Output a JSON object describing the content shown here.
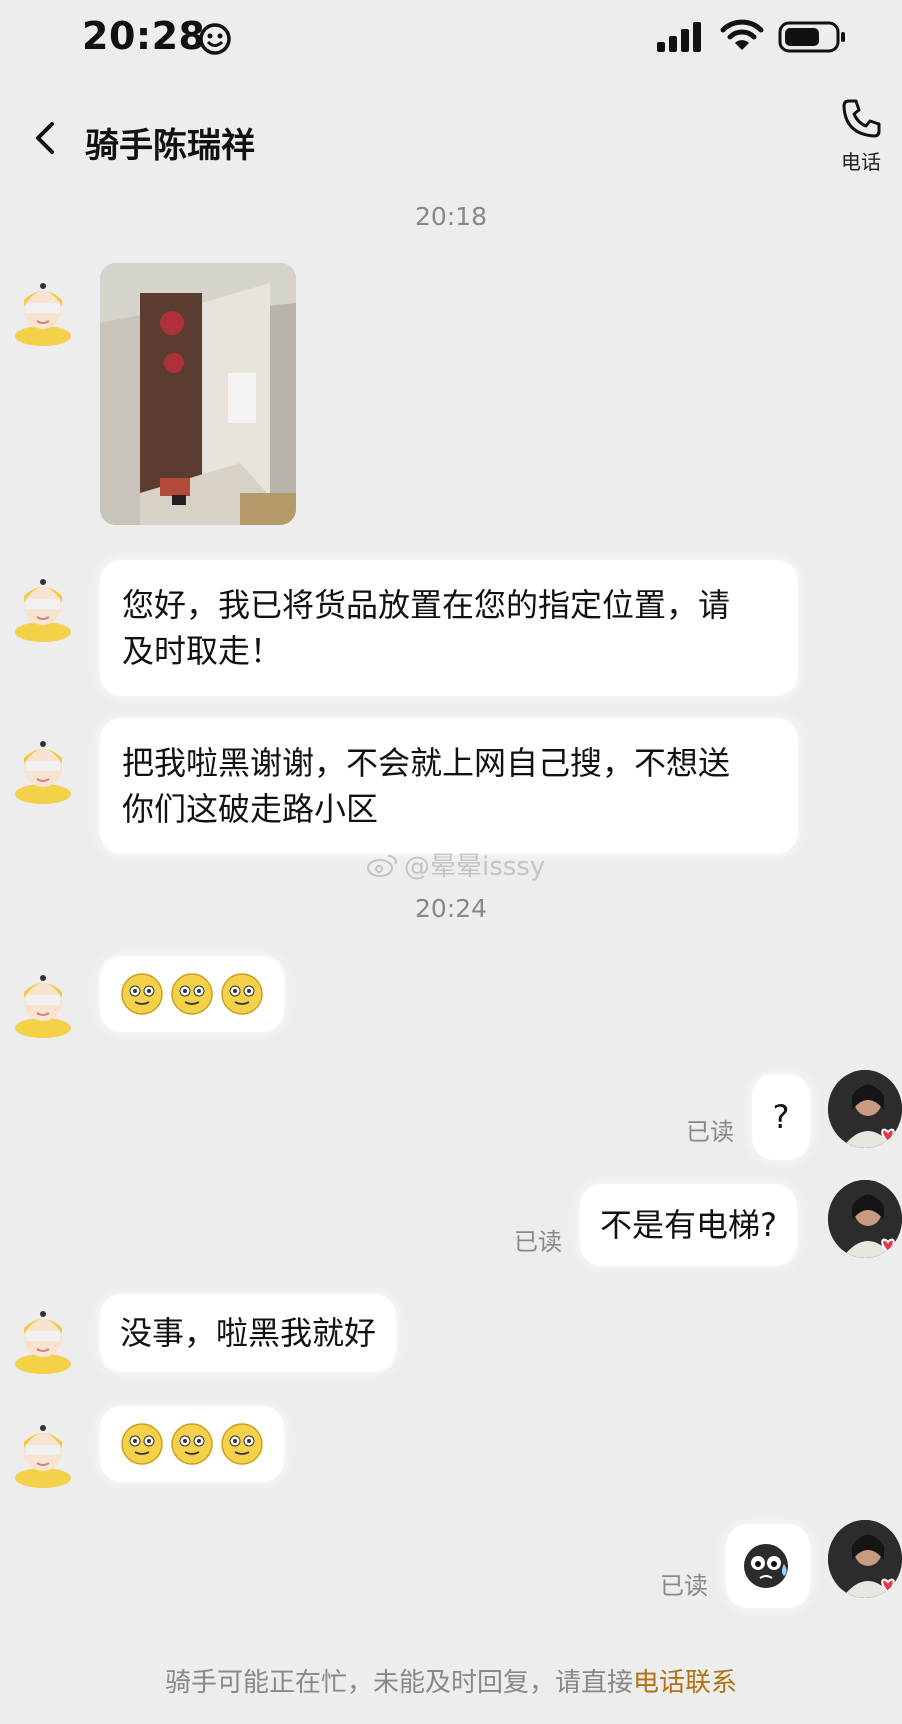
{
  "status_bar": {
    "time": "20:28"
  },
  "header": {
    "title": "骑手陈瑞祥",
    "call_label": "电话"
  },
  "timestamps": [
    "20:18",
    "20:24"
  ],
  "messages": [
    {
      "sender": "rider",
      "type": "image"
    },
    {
      "sender": "rider",
      "type": "text",
      "lines": [
        "您好，我已将货品放置在您的指定位置，请",
        "及时取走！"
      ]
    },
    {
      "sender": "rider",
      "type": "text",
      "lines": [
        "把我啦黑谢谢，不会就上网自己搜，不想送",
        "你们这破走路小区"
      ]
    },
    {
      "sender": "rider",
      "type": "emoji",
      "emojis": [
        "smile-icon",
        "smile-icon",
        "smile-icon"
      ]
    },
    {
      "sender": "me",
      "type": "text",
      "text": "?",
      "read": "已读"
    },
    {
      "sender": "me",
      "type": "text",
      "text": "不是有电梯?",
      "read": "已读"
    },
    {
      "sender": "rider",
      "type": "text",
      "text": "没事，啦黑我就好"
    },
    {
      "sender": "rider",
      "type": "emoji",
      "emojis": [
        "smile-icon",
        "smile-icon",
        "smile-icon"
      ]
    },
    {
      "sender": "me",
      "type": "sticker",
      "sticker": "dizzy-face-sticker",
      "read": "已读"
    }
  ],
  "watermark": "@晕晕isssy",
  "footer": {
    "notice": "骑手可能正在忙，未能及时回复，请直接",
    "link": "电话联系"
  },
  "colors": {
    "background": "#ededed",
    "bubble": "#ffffff",
    "link": "#b07316",
    "muted": "#888888"
  }
}
